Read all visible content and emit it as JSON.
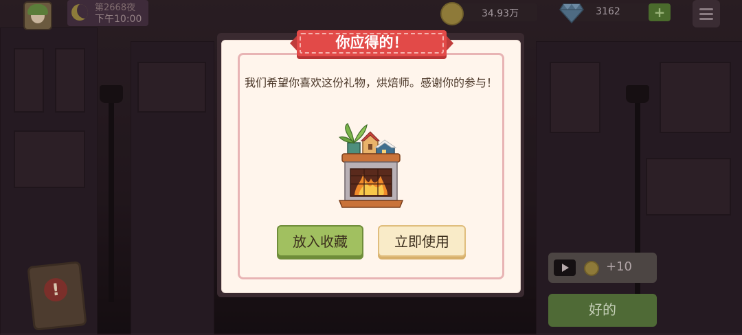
{
  "hud": {
    "night_label": "第2668夜",
    "time_label": "下午10:00",
    "coins": "34.93万",
    "gems": "3162",
    "add_gems_label": "+"
  },
  "dialog": {
    "title": "你应得的！",
    "message": "我们希望你喜欢这份礼物，烘焙师。感谢你的参与！",
    "reward_item_icon": "fireplace-icon",
    "collect_button": "放入收藏",
    "use_button": "立即使用"
  },
  "side": {
    "alert_icon": "exclamation-icon",
    "ad_reward": "+10",
    "ok_button": "好的"
  },
  "colors": {
    "ribbon": "#e24a48",
    "collect_button": "#a1c060",
    "use_button": "#f9ebc8",
    "dialog_bg": "#fff5ec"
  }
}
